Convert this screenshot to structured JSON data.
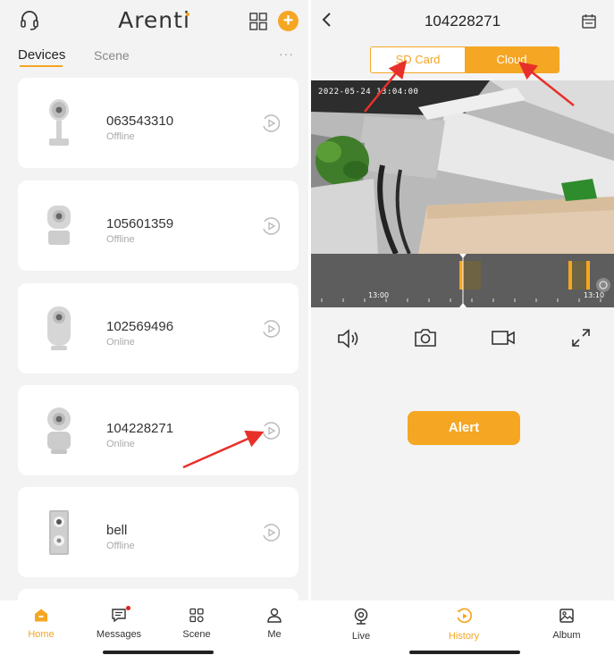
{
  "left": {
    "brand": "Arenti",
    "tabs": {
      "devices": "Devices",
      "scene": "Scene"
    },
    "more": "···",
    "devices": [
      {
        "name": "063543310",
        "status": "Offline",
        "icon": "camera-stand-icon"
      },
      {
        "name": "105601359",
        "status": "Offline",
        "icon": "camera-cube-icon"
      },
      {
        "name": "102569496",
        "status": "Online",
        "icon": "camera-dome-icon"
      },
      {
        "name": "104228271",
        "status": "Online",
        "icon": "camera-pan-tilt-icon"
      },
      {
        "name": "bell",
        "status": "Offline",
        "icon": "doorbell-icon"
      }
    ],
    "nav": [
      {
        "label": "Home",
        "icon": "home-icon",
        "active": true
      },
      {
        "label": "Messages",
        "icon": "message-icon",
        "active": false
      },
      {
        "label": "Scene",
        "icon": "scene-icon",
        "active": false
      },
      {
        "label": "Me",
        "icon": "person-icon",
        "active": false
      }
    ]
  },
  "right": {
    "title": "104228271",
    "segments": {
      "sd": "SD Card",
      "cloud": "Cloud"
    },
    "video_timestamp": "2022-05-24 13:04:00",
    "timeline": {
      "labels": [
        "13:00",
        "13:10"
      ]
    },
    "controls": [
      "speaker-icon",
      "snapshot-icon",
      "record-icon",
      "fullscreen-icon"
    ],
    "alert_label": "Alert",
    "nav": [
      {
        "label": "Live",
        "icon": "webcam-icon",
        "active": false
      },
      {
        "label": "History",
        "icon": "history-play-icon",
        "active": true
      },
      {
        "label": "Album",
        "icon": "album-icon",
        "active": false
      }
    ]
  },
  "colors": {
    "accent": "#f5a623",
    "annotation_arrow": "#e8302a",
    "background": "#f3f3f3"
  }
}
